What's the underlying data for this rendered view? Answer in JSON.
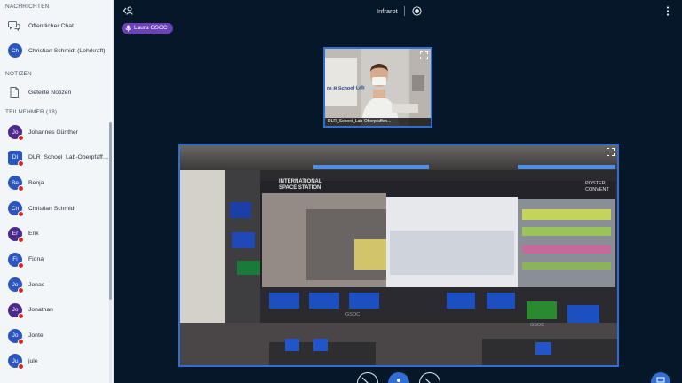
{
  "sidebar": {
    "messages_title": "NACHRICHTEN",
    "public_chat": "Öffentlicher Chat",
    "private_chat": {
      "initials": "Ch",
      "name": "Christian Schmidt (Lehrkraft)"
    },
    "notes_title": "NOTIZEN",
    "shared_notes": "Geteilte Notizen",
    "participants_title": "TEILNEHMER (18)",
    "participants": [
      {
        "initials": "Jo",
        "name": "Johannes Günther",
        "color": "#4b2a8e"
      },
      {
        "initials": "DI",
        "name": "DLR_School_Lab-Oberpfaffe...",
        "color": "#2a56c0"
      },
      {
        "initials": "Be",
        "name": "Benja",
        "color": "#2a56c0"
      },
      {
        "initials": "Ch",
        "name": "Christian Schmidt",
        "color": "#2a56c0"
      },
      {
        "initials": "Er",
        "name": "Erik",
        "color": "#4b2a8e"
      },
      {
        "initials": "Fi",
        "name": "Fiona",
        "color": "#2a56c0"
      },
      {
        "initials": "Jo",
        "name": "Jonas",
        "color": "#2a56c0"
      },
      {
        "initials": "Jo",
        "name": "Jonathan",
        "color": "#4b2a8e"
      },
      {
        "initials": "Jo",
        "name": "Jonte",
        "color": "#2a56c0"
      },
      {
        "initials": "Ju",
        "name": "jule",
        "color": "#2a56c0"
      }
    ]
  },
  "topbar": {
    "title": "Infrarot"
  },
  "presenter": {
    "name": "Laura GSOC"
  },
  "camera": {
    "caption": "DLR_School_Lab-Oberpfaffen..."
  },
  "screen_share": {
    "wall_text": [
      "INTERNATIONAL",
      "SPACE STATION"
    ],
    "right_text": [
      "POSTER",
      "CONVENT"
    ],
    "floor_text": [
      "GSOC",
      "GSOC"
    ]
  },
  "colors": {
    "accent": "#2f6fd4",
    "background": "#06172a",
    "sidebar": "#f3f6f9",
    "presenter_pill": "#6b42b8",
    "mic_muted": "#df2721"
  }
}
